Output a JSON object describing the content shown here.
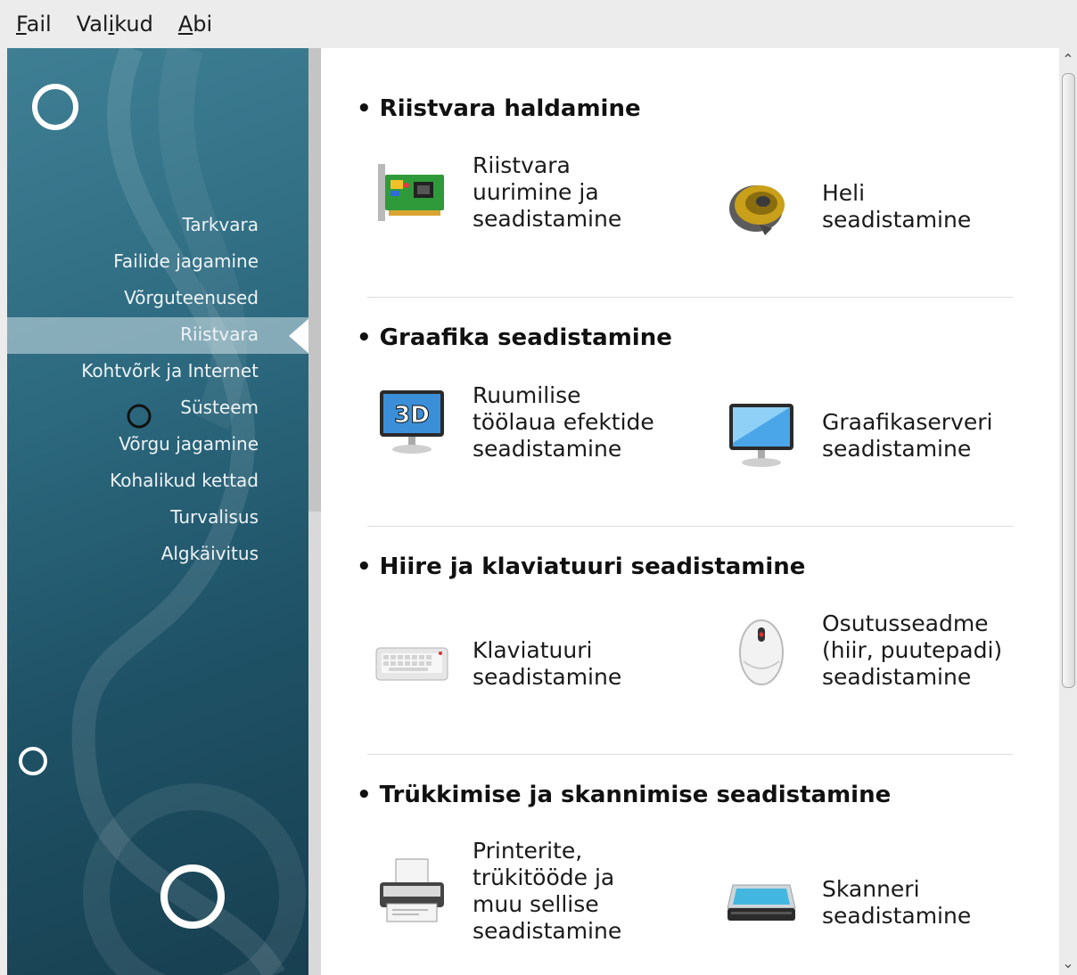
{
  "menubar": {
    "items": [
      {
        "pre": "",
        "key": "F",
        "post": "ail"
      },
      {
        "pre": "Val",
        "key": "i",
        "post": "kud"
      },
      {
        "pre": "",
        "key": "A",
        "post": "bi"
      }
    ]
  },
  "sidebar": {
    "items": [
      "Tarkvara",
      "Failide jagamine",
      "Võrguteenused",
      "Riistvara",
      "Kohtvõrk ja Internet",
      "Süsteem",
      "Võrgu jagamine",
      "Kohalikud kettad",
      "Turvalisus",
      "Algkäivitus"
    ],
    "active": "Riistvara"
  },
  "sections": [
    {
      "title": "Riistvara haldamine",
      "tools": [
        {
          "icon": "hardware-card-icon",
          "label": "Riistvara uurimine ja seadistamine"
        },
        {
          "icon": "speaker-icon",
          "label": "Heli seadistamine"
        }
      ]
    },
    {
      "title": "Graafika seadistamine",
      "tools": [
        {
          "icon": "3d-monitor-icon",
          "label": "Ruumilise töölaua efektide seadistamine",
          "icon_text": "3D"
        },
        {
          "icon": "monitor-icon",
          "label": "Graafikaserveri seadistamine"
        }
      ]
    },
    {
      "title": "Hiire ja klaviatuuri seadistamine",
      "tools": [
        {
          "icon": "keyboard-icon",
          "label": "Klaviatuuri seadistamine"
        },
        {
          "icon": "mouse-icon",
          "label": "Osutusseadme (hiir, puutepadi) seadistamine"
        }
      ]
    },
    {
      "title": "Trükkimise ja skannimise seadistamine",
      "tools": [
        {
          "icon": "printer-icon",
          "label": "Printerite, trükitööde ja muu sellise seadistamine"
        },
        {
          "icon": "scanner-icon",
          "label": "Skanneri seadistamine"
        }
      ]
    }
  ],
  "colors": {
    "sidebar": "#2d6a80",
    "active_item": "#c8d9e0",
    "content_bg": "#ffffff"
  }
}
